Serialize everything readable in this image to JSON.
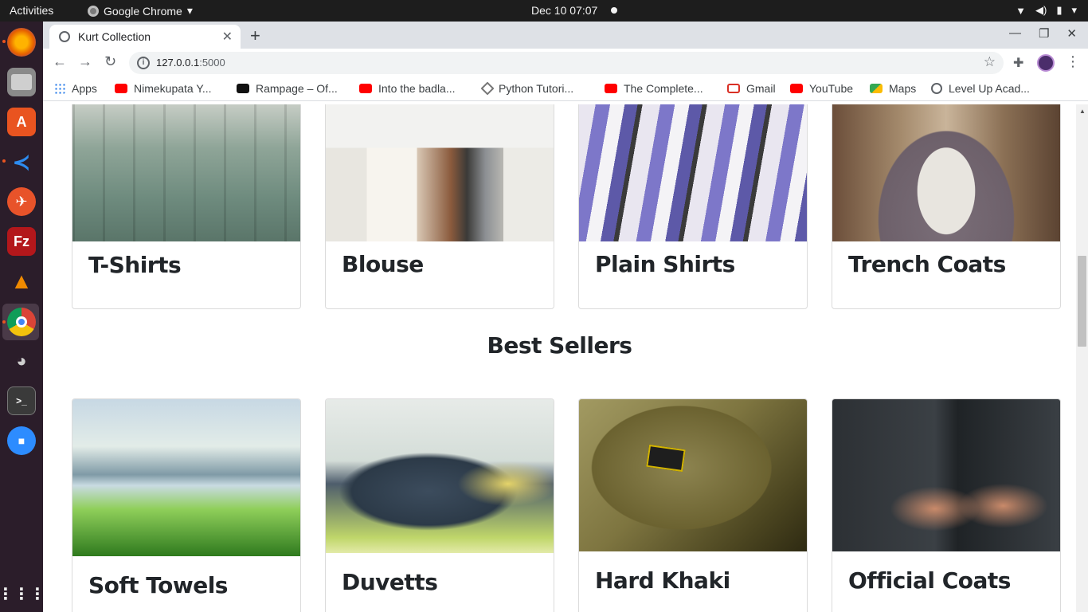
{
  "topbar": {
    "activities": "Activities",
    "app_name": "Google Chrome",
    "clock": "Dec 10  07:07"
  },
  "browser": {
    "tab_title": "Kurt Collection",
    "url_host": "127.0.0.1",
    "url_port": ":5000",
    "new_tab": "+",
    "tab_close": "✕"
  },
  "bookmarks": [
    {
      "label": "Apps",
      "icon": "apps-icon"
    },
    {
      "label": "Nimekupata Y...",
      "icon": "youtube-icon"
    },
    {
      "label": "Rampage – Of...",
      "icon": "rampage-icon"
    },
    {
      "label": "Into the badla...",
      "icon": "youtube-icon"
    },
    {
      "label": "Python Tutori...",
      "icon": "python-icon"
    },
    {
      "label": "The Complete...",
      "icon": "youtube-icon"
    },
    {
      "label": "Gmail",
      "icon": "gmail-icon"
    },
    {
      "label": "YouTube",
      "icon": "youtube-icon"
    },
    {
      "label": "Maps",
      "icon": "maps-icon"
    },
    {
      "label": "Level Up Acad...",
      "icon": "globe-icon"
    }
  ],
  "categories": [
    {
      "title": "T-Shirts"
    },
    {
      "title": "Blouse"
    },
    {
      "title": "Plain Shirts"
    },
    {
      "title": "Trench Coats"
    }
  ],
  "best_sellers": {
    "heading": "Best Sellers",
    "items": [
      {
        "title": "Soft Towels"
      },
      {
        "title": "Duvetts"
      },
      {
        "title": "Hard Khaki"
      },
      {
        "title": "Official Coats"
      }
    ]
  },
  "colors": {
    "page_bg": "#ffffff",
    "heading_text": "#212529",
    "dock_bg": "#2b1d2a",
    "topbar_bg": "#1d1d1d"
  }
}
